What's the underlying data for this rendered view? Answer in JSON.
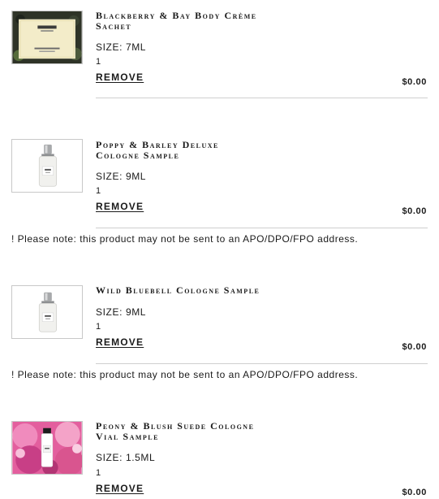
{
  "items": [
    {
      "name_line1": "Blackberry & Bay Body Crème",
      "name_line2": "Sachet",
      "size": "SIZE: 7ML",
      "quantity": "1",
      "remove_label": "REMOVE",
      "price": "$0.00",
      "thumbnail_icon": "sachet-image"
    },
    {
      "name_line1": "Poppy & Barley Deluxe",
      "name_line2": "Cologne Sample",
      "size": "SIZE: 9ML",
      "quantity": "1",
      "remove_label": "REMOVE",
      "price": "$0.00",
      "note": "! Please note: this product may not be sent to an APO/DPO/FPO address.",
      "thumbnail_icon": "cologne-bottle-image"
    },
    {
      "name_line1": "Wild Bluebell Cologne Sample",
      "name_line2": "",
      "size": "SIZE: 9ML",
      "quantity": "1",
      "remove_label": "REMOVE",
      "price": "$0.00",
      "note": "! Please note: this product may not be sent to an APO/DPO/FPO address.",
      "thumbnail_icon": "cologne-bottle-image"
    },
    {
      "name_line1": "Peony & Blush Suede Cologne",
      "name_line2": "Vial Sample",
      "size": "SIZE: 1.5ML",
      "quantity": "1",
      "remove_label": "REMOVE",
      "price": "$0.00",
      "thumbnail_icon": "peony-vial-image"
    }
  ]
}
